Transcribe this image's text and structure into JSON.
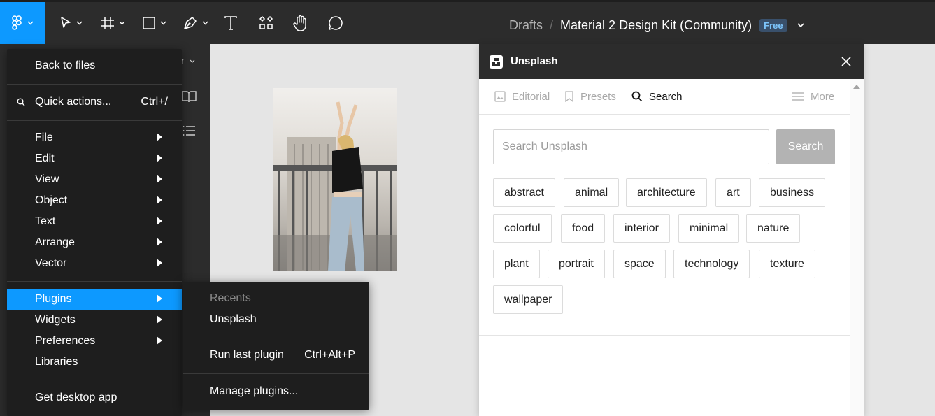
{
  "toolbar": {
    "main_menu_icon": "figma-logo-icon",
    "tools": [
      "move-tool-icon",
      "frame-tool-icon",
      "shape-tool-icon",
      "pen-tool-icon",
      "text-tool-icon",
      "resources-icon",
      "hand-tool-icon",
      "comment-icon"
    ],
    "breadcrumb_parent": "Drafts",
    "breadcrumb_sep": "/",
    "file_name": "Material 2 Design Kit (Community)",
    "plan_badge": "Free"
  },
  "left_panel": {
    "partial_label": "r"
  },
  "main_menu": {
    "back": "Back to files",
    "quick_actions": "Quick actions...",
    "quick_actions_shortcut": "Ctrl+/",
    "items": [
      {
        "label": "File"
      },
      {
        "label": "Edit"
      },
      {
        "label": "View"
      },
      {
        "label": "Object"
      },
      {
        "label": "Text"
      },
      {
        "label": "Arrange"
      },
      {
        "label": "Vector"
      }
    ],
    "plugins": "Plugins",
    "widgets": "Widgets",
    "preferences": "Preferences",
    "libraries": "Libraries",
    "desktop_app": "Get desktop app"
  },
  "plugins_submenu": {
    "recents_header": "Recents",
    "recent_item": "Unsplash",
    "run_last": "Run last plugin",
    "run_last_shortcut": "Ctrl+Alt+P",
    "manage": "Manage plugins..."
  },
  "plugin_window": {
    "title": "Unsplash",
    "tabs": {
      "editorial": "Editorial",
      "presets": "Presets",
      "search": "Search",
      "more": "More"
    },
    "search_placeholder": "Search Unsplash",
    "search_button": "Search",
    "tags": [
      "abstract",
      "animal",
      "architecture",
      "art",
      "business",
      "colorful",
      "food",
      "interior",
      "minimal",
      "nature",
      "plant",
      "portrait",
      "space",
      "technology",
      "texture",
      "wallpaper"
    ]
  },
  "colors": {
    "accent": "#0d99ff",
    "toolbar_bg": "#2c2c2c",
    "menu_bg": "#1e1e1e",
    "badge_bg": "#39506b",
    "badge_text": "#7cc4fa"
  }
}
